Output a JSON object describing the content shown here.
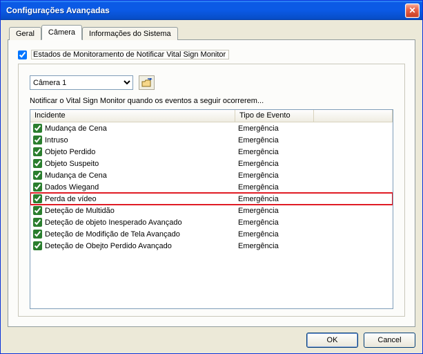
{
  "titlebar": {
    "title": "Configurações Avançadas"
  },
  "tabs": {
    "geral": "Geral",
    "camera": "Câmera",
    "info": "Informações do Sistema"
  },
  "group_checkbox_label": "Estados de Monitoramento de Notificar Vital Sign Monitor",
  "camera_select": {
    "value": "Câmera 1",
    "options": [
      "Câmera 1"
    ]
  },
  "description": "Notificar o Vital Sign Monitor quando os eventos a seguir ocorrerem...",
  "columns": {
    "incident": "Incidente",
    "event_type": "Tipo de Evento"
  },
  "rows": [
    {
      "checked": true,
      "incident": "Mudança de Cena",
      "event_type": "Emergência",
      "highlight": false
    },
    {
      "checked": true,
      "incident": "Intruso",
      "event_type": "Emergência",
      "highlight": false
    },
    {
      "checked": true,
      "incident": "Objeto Perdido",
      "event_type": "Emergência",
      "highlight": false
    },
    {
      "checked": true,
      "incident": "Objeto Suspeito",
      "event_type": "Emergência",
      "highlight": false
    },
    {
      "checked": true,
      "incident": "Mudança de Cena",
      "event_type": "Emergência",
      "highlight": false
    },
    {
      "checked": true,
      "incident": "Dados Wiegand",
      "event_type": "Emergência",
      "highlight": false
    },
    {
      "checked": true,
      "incident": "Perda de vídeo",
      "event_type": "Emergência",
      "highlight": true
    },
    {
      "checked": true,
      "incident": "Deteção de Multidão",
      "event_type": "Emergência",
      "highlight": false
    },
    {
      "checked": true,
      "incident": "Deteção de objeto Inesperado Avançado",
      "event_type": "Emergência",
      "highlight": false
    },
    {
      "checked": true,
      "incident": "Deteção de Modifição de Tela Avançado",
      "event_type": "Emergência",
      "highlight": false
    },
    {
      "checked": true,
      "incident": "Deteção de Obejto Perdido Avançado",
      "event_type": "Emergência",
      "highlight": false
    }
  ],
  "buttons": {
    "ok": "OK",
    "cancel": "Cancel"
  }
}
